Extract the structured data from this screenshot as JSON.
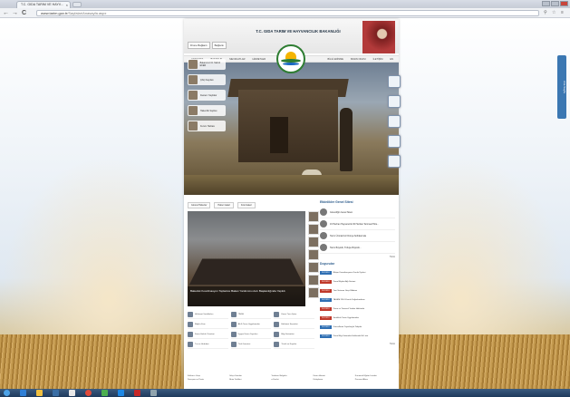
{
  "browser": {
    "tab_title": "T.C. GIDA TARIM VE HAYV...",
    "tab_close": "×",
    "url_host": "www.tarim.gov.tr",
    "url_path": "/Sayfalar/Anasayfa.aspx",
    "back": "←",
    "forward": "→",
    "reload": "C"
  },
  "site": {
    "title": "T.C. GIDA TARIM VE HAYVANCILIK BAKANLIĞI",
    "header_buttons": [
      "Drone Bağlantı",
      "Bağlantı"
    ],
    "menu": [
      "ANASAYFA",
      "BAKANLIK",
      "MEVZUATLAR",
      "HİZMETLER",
      "BİLGİ EDİNME",
      "BASIN ODASI",
      "İLETİŞİM",
      "EN"
    ],
    "left_list": [
      "Bakanımız Dr. Mehdi EKER",
      "Çiftçi Kayıtları",
      "Destek / Sayfalar",
      "Hakemlik Sayfası",
      "Kurum Haritası"
    ],
    "news_tabs": [
      "Güncel Haberler",
      "Haber Galeri",
      "Foto Galeri"
    ],
    "news_caption": "Bakanlık Koordinasyon Toplantısı Bakan Yardımcısı Avcı Başkanlığında Yapıldı",
    "services": [
      "Hükümet Sertifikaları",
      "TİHSE",
      "Kamu Tuzu İşlem",
      "Bilgiler Kanı",
      "Akıllı Tarım Uygulamaları",
      "Hükümet Seçimleri",
      "Kamu Hukuk Yönetimi",
      "Uygun Kamu Yayınları",
      "Bilgi Sistemleri",
      "Tuz ve Hububat",
      "Türk Gazetesi",
      "Tüzük ve Kayıtlar"
    ],
    "events_title": "Etkinlikler Genel Sitesi",
    "events": [
      "Güvenliğin Genel Sitesi",
      "16 Haziran Hayvancılık 30 Haziran Tarımsal Hiza...",
      "Tarım Ürünlerimiz Dünya Sofralarında",
      "Tarım Büyüdü, Türkiye Büyüdü..."
    ],
    "more": "Tümü",
    "announcements_title": "Duyurular",
    "announcements": [
      {
        "tag": "DUYURU",
        "text": "Bilişim Koordinasyonu Kurulu Üyeleri",
        "color": "blue"
      },
      {
        "tag": "DUYURU",
        "text": "Tarım Bilgileri Ağı Sistemi",
        "color": "red"
      },
      {
        "tag": "DUYURU",
        "text": "Yeni Sisteme Girişi Bildirimi",
        "color": "red"
      },
      {
        "tag": "DUYURU",
        "text": "TAGEM 2014 Kurulu Değerlendirme",
        "color": "blue"
      },
      {
        "tag": "DUYURU",
        "text": "Tarım ve Tarımsal Yardım Hakkında",
        "color": "red"
      },
      {
        "tag": "DUYURU",
        "text": "Sertifikalı Tarım Uygulamaları",
        "color": "red"
      },
      {
        "tag": "DUYURU",
        "text": "Güncelleme Yayınlarıyla Talepler",
        "color": "blue"
      },
      {
        "tag": "DUYURU",
        "text": "Tarım Bilgi Sistemleri Hakkında Ek Liste",
        "color": "blue"
      }
    ],
    "footer_links": [
      "Kullanıcı Girişi",
      "Sıkça Sorulan",
      "Yardımcı Belgeler",
      "Kamu Hizmet",
      "Kurumsal Eğitim Listeleri",
      "Danışma ve Posta",
      "Birim Yetkileri",
      "e-Devlet",
      "Kütüphane",
      "Personel Alımı"
    ]
  },
  "side_tab": "Ana Sayfa"
}
